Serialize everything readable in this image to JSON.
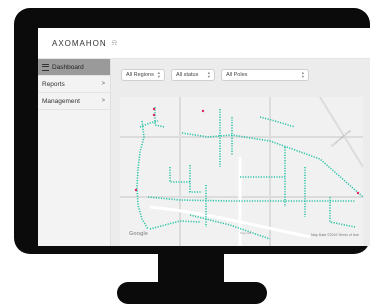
{
  "app": {
    "logo_text": "AXOMAHON"
  },
  "sidebar": {
    "items": [
      {
        "label": "Dashboard",
        "icon": "menu-icon",
        "active": true
      },
      {
        "label": "Reports",
        "chevron": ">"
      },
      {
        "label": "Management",
        "chevron": ">"
      }
    ]
  },
  "filters": {
    "regions": "All Regions",
    "status": "All status",
    "poles": "All Poles"
  },
  "map": {
    "attribution": "Map Data ©2019   Terms of Use",
    "provider_mark": "Google",
    "road_label": "Sixty Rd",
    "pole_color": "#2ec4a7",
    "alert_color": "#e0245e"
  }
}
